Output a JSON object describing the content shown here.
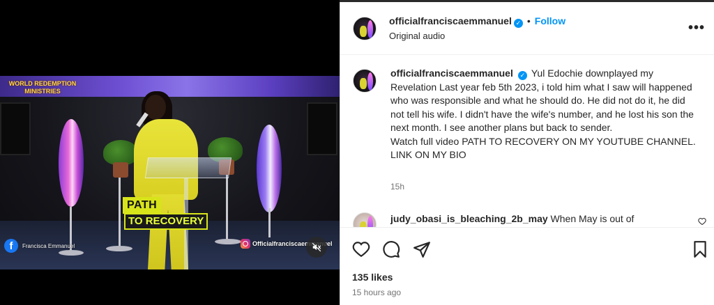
{
  "post": {
    "username": "officialfranciscaemmanuel",
    "verified": true,
    "follow_label": "Follow",
    "dot": "•",
    "audio": "Original audio",
    "more": "•••"
  },
  "caption": {
    "username": "officialfranciscaemmanuel",
    "text": "Yul Edochie downplayed my Revelation Last year feb 5th 2023, i told him what I saw will happened who was responsible and what he should do. He did not do it, he did not tell his wife. I didn't have the wife's number, and he lost his son the next month. I see another plans but back to sender.\nWatch full video PATH TO RECOVERY ON MY YOUTUBE CHANNEL. LINK ON MY BIO",
    "time": "15h"
  },
  "comment": {
    "username": "judy_obasi_is_bleaching_2b_may",
    "text": "When May is out of"
  },
  "stats": {
    "likes": "135 likes",
    "ago": "15 hours ago"
  },
  "video": {
    "church_name": "WORLD REDEMPTION MINISTRIES",
    "path_label": "PATH",
    "recovery_label": "TO RECOVERY",
    "facebook_handle": "Francisca Emmanuel",
    "instagram_handle": "Officialfranciscaemmanuel",
    "muted": true
  },
  "colors": {
    "accent": "#0095f6",
    "highlight": "#d8e41a"
  },
  "icons": [
    "heart-icon",
    "comment-icon",
    "share-icon",
    "bookmark-icon",
    "mute-icon",
    "more-icon",
    "verified-icon",
    "facebook-icon",
    "instagram-icon"
  ]
}
